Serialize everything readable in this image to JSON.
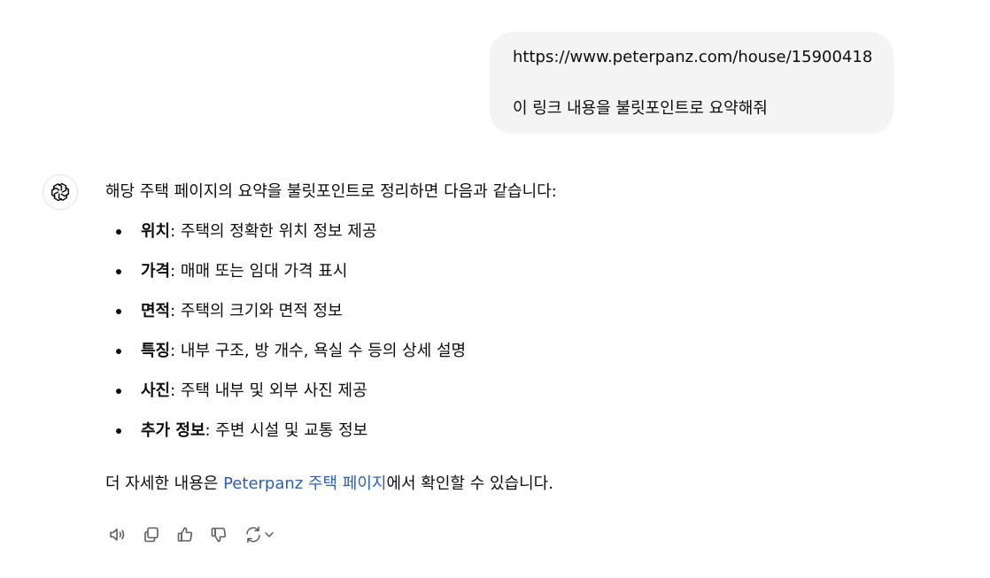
{
  "user_message": {
    "url": "https://www.peterpanz.com/house/15900418",
    "request": "이 링크 내용을 불릿포인트로 요약해줘"
  },
  "assistant_message": {
    "intro": "해당 주택 페이지의 요약을 불릿포인트로 정리하면 다음과 같습니다:",
    "bullets": [
      {
        "term": "위치",
        "text": ": 주택의 정확한 위치 정보 제공"
      },
      {
        "term": "가격",
        "text": ": 매매 또는 임대 가격 표시"
      },
      {
        "term": "면적",
        "text": ": 주택의 크기와 면적 정보"
      },
      {
        "term": "특징",
        "text": ": 내부 구조, 방 개수, 욕실 수 등의 상세 설명"
      },
      {
        "term": "사진",
        "text": ": 주택 내부 및 외부 사진 제공"
      },
      {
        "term": "추가 정보",
        "text": ": 주변 시설 및 교통 정보"
      }
    ],
    "outro_prefix": "더 자세한 내용은 ",
    "outro_link": "Peterpanz 주택 페이지",
    "outro_suffix": "에서 확인할 수 있습니다."
  },
  "actions": {
    "read_aloud": "speaker-icon",
    "copy": "copy-icon",
    "good": "thumbs-up-icon",
    "bad": "thumbs-down-icon",
    "regenerate": "regenerate-icon"
  },
  "colors": {
    "bubble_bg": "#f4f4f4",
    "link": "#2c5fb0",
    "text": "#0d0d0d",
    "icon": "#5d5d5d"
  }
}
